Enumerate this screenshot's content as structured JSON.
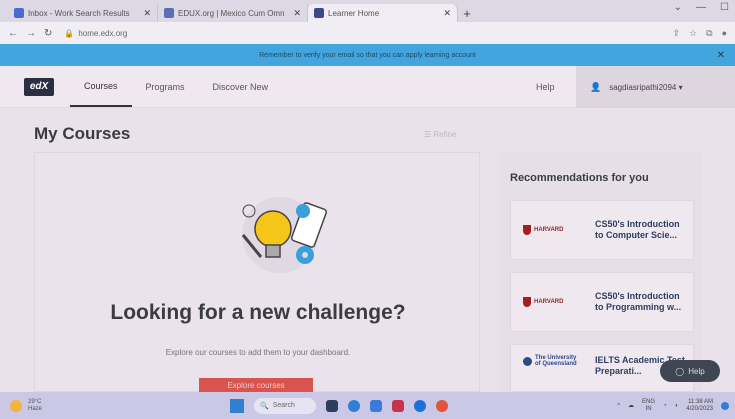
{
  "browser": {
    "tabs": [
      {
        "label": "Inbox - Work Search Results",
        "color": "#4a6bd1"
      },
      {
        "label": "EDUX.org | Mexico Cum Omn",
        "color": "#5a6fb5"
      },
      {
        "label": "Learner Home",
        "color": "#3b4a8a"
      }
    ],
    "url": "home.edx.org"
  },
  "banner": {
    "text": "Remember to verify your email so that you can apply learning account"
  },
  "header": {
    "logo": "edX",
    "nav": [
      "Courses",
      "Programs",
      "Discover New"
    ],
    "help": "Help",
    "username": "sagdiasripathi2094"
  },
  "main": {
    "title": "My Courses",
    "refine": "Refine",
    "heading": "Looking for a new challenge?",
    "subtext": "Explore our courses to add them to your dashboard.",
    "button": "Explore courses"
  },
  "recommendations": {
    "title": "Recommendations for you",
    "items": [
      {
        "org": "HARVARD",
        "title": "CS50's Introduction to Computer Scie..."
      },
      {
        "org": "HARVARD",
        "title": "CS50's Introduction to Programming w..."
      },
      {
        "org": "The University of Queensland",
        "title": "IELTS Academic Test Preparati..."
      }
    ]
  },
  "help_float": "Help",
  "taskbar": {
    "temp": "29°C",
    "weather": "Haze",
    "search": "Search",
    "lang": "ENG",
    "region": "IN",
    "time": "11:38 AM",
    "date": "4/20/2023"
  },
  "colors": {
    "banner": "#42a5dd",
    "explore_button": "#d9534f",
    "recommend_title_text": "#2d3e63"
  }
}
